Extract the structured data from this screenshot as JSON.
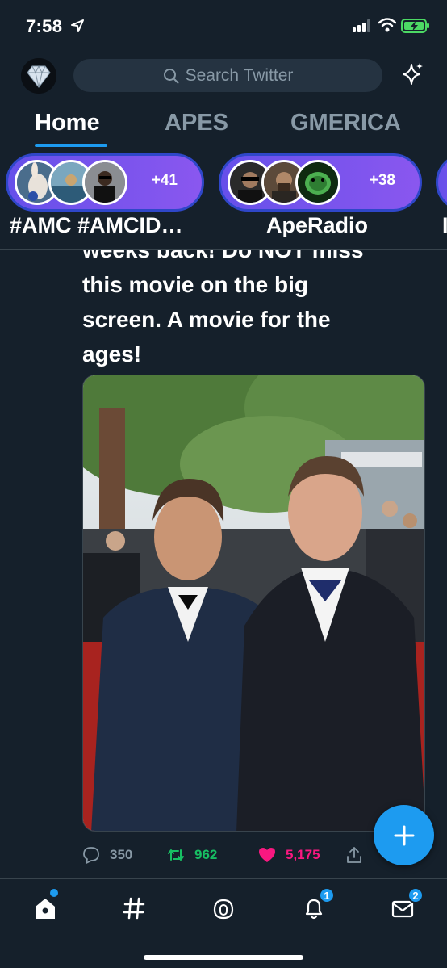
{
  "status": {
    "time": "7:58"
  },
  "search": {
    "placeholder": "Search Twitter"
  },
  "tabs": [
    {
      "label": "Home",
      "active": true
    },
    {
      "label": "APES",
      "active": false
    },
    {
      "label": "GMERICA",
      "active": false
    }
  ],
  "spaces": [
    {
      "count": "+41",
      "title": "#AMC #AMCID…"
    },
    {
      "count": "+38",
      "title": "ApeRadio"
    },
    {
      "count": "",
      "title": "I"
    }
  ],
  "tweet": {
    "text_lines": [
      "weeks back! Do NOT miss",
      "this movie on the big",
      "screen. A movie for the",
      "ages!"
    ],
    "replies": "350",
    "retweets": "962",
    "likes": "5,175"
  },
  "nav": {
    "notifications_badge": "1",
    "messages_badge": "2"
  },
  "colors": {
    "background": "#15202b",
    "accent": "#1d9bf0",
    "retweet": "#17bf63",
    "like": "#f91880",
    "space_pill": "#6650ea"
  },
  "icons": [
    "location-arrow-icon",
    "signal-icon",
    "wifi-icon",
    "battery-icon",
    "search-icon",
    "sparkle-icon",
    "reply-icon",
    "retweet-icon",
    "heart-icon",
    "share-icon",
    "compose-icon",
    "home-icon",
    "hashtag-icon",
    "spaces-icon",
    "bell-icon",
    "envelope-icon"
  ]
}
